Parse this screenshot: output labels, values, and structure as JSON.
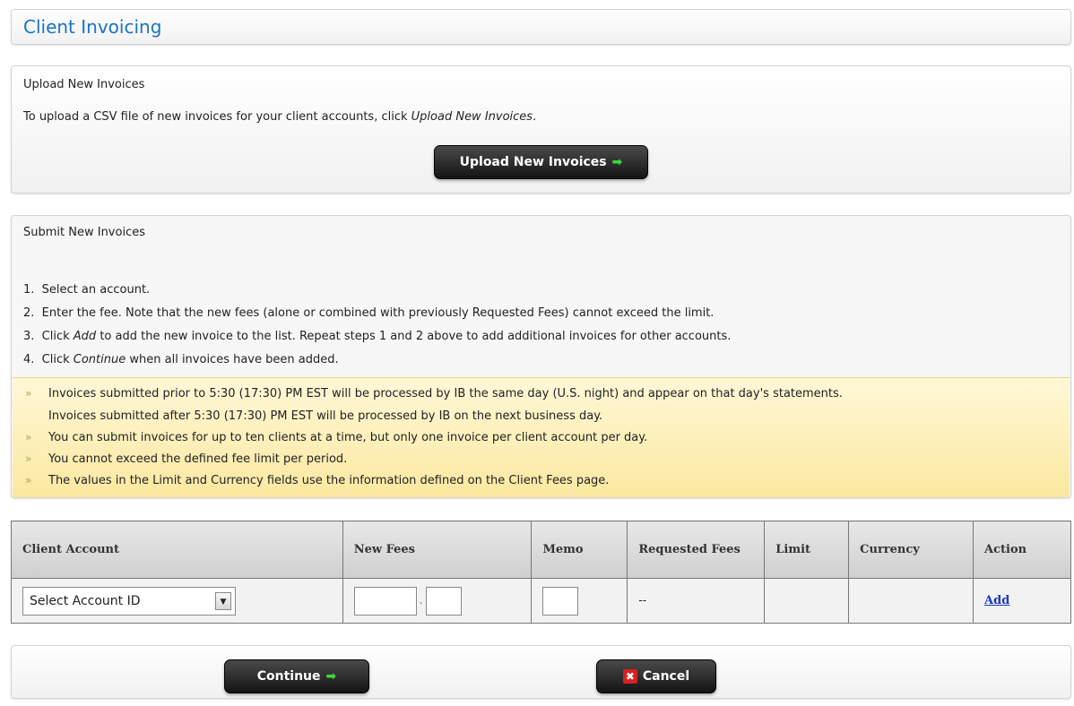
{
  "header": {
    "title": "Client Invoicing"
  },
  "upload": {
    "heading": "Upload New Invoices",
    "text_before": "To upload a CSV file of new invoices for your client accounts, click ",
    "text_emphasis": "Upload New Invoices",
    "text_after": ".",
    "button_label": "Upload New Invoices"
  },
  "submit": {
    "heading": "Submit New Invoices",
    "steps": [
      {
        "num": "1.",
        "pre": "Select an account.",
        "em": "",
        "post": ""
      },
      {
        "num": "2.",
        "pre": "Enter the fee. Note that the new fees (alone or combined with previously Requested Fees) cannot exceed the limit.",
        "em": "",
        "post": ""
      },
      {
        "num": "3.",
        "pre": "Click ",
        "em": "Add",
        "post": " to add the new invoice to the list. Repeat steps 1 and 2 above to add additional invoices for other accounts."
      },
      {
        "num": "4.",
        "pre": "Click ",
        "em": "Continue",
        "post": " when all invoices have been added."
      }
    ],
    "notices": [
      "Invoices submitted prior to 5:30 (17:30) PM EST will be processed by IB the same day (U.S. night) and appear on that day's statements.",
      "Invoices submitted after 5:30 (17:30) PM EST will be processed by IB on the next business day.",
      "You can submit invoices for up to ten clients at a time, but only one invoice per client account per day.",
      "You cannot exceed the defined fee limit per period.",
      "The values in the Limit and Currency fields use the information defined on the Client Fees page."
    ],
    "notice_bullet": "»"
  },
  "table": {
    "headers": [
      "Client Account",
      "New Fees",
      "Memo",
      "Requested Fees",
      "Limit",
      "Currency",
      "Action"
    ],
    "row": {
      "account_select": "Select Account ID",
      "fee_whole": "",
      "fee_decimal_sep": ".",
      "fee_fraction": "",
      "memo": "",
      "requested_fees": "--",
      "limit": "",
      "currency": "",
      "action": "Add"
    }
  },
  "footer": {
    "continue_label": "Continue",
    "cancel_label": "Cancel"
  },
  "icons": {
    "arrow": "green-right-arrow-icon",
    "cancel": "red-x-icon",
    "dropdown": "chevron-down-icon"
  },
  "colors": {
    "title": "#1a73c8",
    "notice_bg": "#fbe8a0",
    "link": "#1a39c8",
    "arrow": "#3cd83c",
    "cancel_icon": "#d92020"
  }
}
